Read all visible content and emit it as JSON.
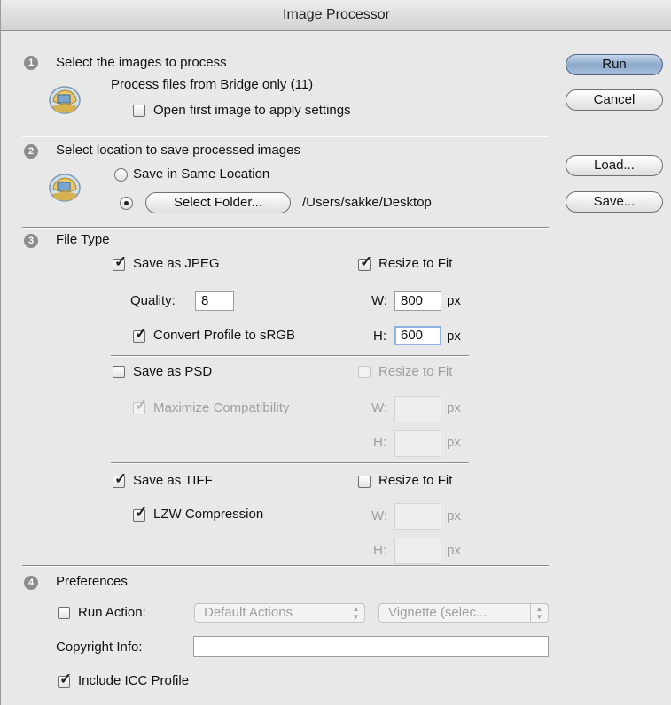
{
  "window": {
    "title": "Image Processor"
  },
  "section1": {
    "number": "1",
    "heading": "Select the images to process",
    "source_text": "Process files from Bridge only (11)",
    "open_first_label": "Open first image to apply settings",
    "open_first_checked": false
  },
  "section2": {
    "number": "2",
    "heading": "Select location to save processed images",
    "same_location_label": "Save in Same Location",
    "select_folder_label": "Select Folder...",
    "folder_path": "/Users/sakke/Desktop",
    "selected_option": "select_folder"
  },
  "section3": {
    "number": "3",
    "heading": "File Type",
    "jpeg": {
      "label": "Save as JPEG",
      "checked": true,
      "resize_label": "Resize to Fit",
      "resize_checked": true,
      "quality_label": "Quality:",
      "quality_value": "8",
      "convert_label": "Convert Profile to sRGB",
      "convert_checked": true,
      "w_label": "W:",
      "w_value": "800",
      "h_label": "H:",
      "h_value": "600",
      "unit": "px"
    },
    "psd": {
      "label": "Save as PSD",
      "checked": false,
      "resize_label": "Resize to Fit",
      "resize_checked": false,
      "maximize_label": "Maximize Compatibility",
      "maximize_checked": true,
      "w_label": "W:",
      "w_value": "",
      "h_label": "H:",
      "h_value": "",
      "unit": "px"
    },
    "tiff": {
      "label": "Save as TIFF",
      "checked": true,
      "resize_label": "Resize to Fit",
      "resize_checked": false,
      "lzw_label": "LZW Compression",
      "lzw_checked": true,
      "w_label": "W:",
      "w_value": "",
      "h_label": "H:",
      "h_value": "",
      "unit": "px"
    }
  },
  "section4": {
    "number": "4",
    "heading": "Preferences",
    "run_action_label": "Run Action:",
    "run_action_checked": false,
    "action_set": "Default Actions",
    "action": "Vignette (selec...",
    "copyright_label": "Copyright Info:",
    "copyright_value": "",
    "icc_label": "Include ICC Profile",
    "icc_checked": true
  },
  "buttons": {
    "run": "Run",
    "cancel": "Cancel",
    "load": "Load...",
    "save": "Save..."
  },
  "colors": {
    "default_button": "#9fb6d6",
    "focus_ring": "#8fb2e3",
    "disabled_text": "#9f9f9f"
  },
  "icons": {
    "section_icon": "bridge-folder-icon",
    "checkmark": "checkmark-icon"
  }
}
